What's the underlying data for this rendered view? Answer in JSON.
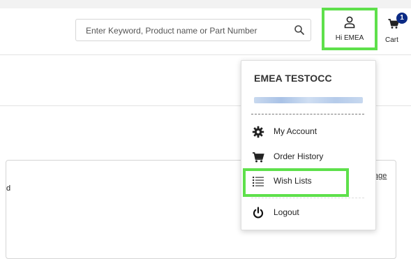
{
  "header": {
    "search_placeholder": "Enter Keyword, Product name or Part Number",
    "account_label": "Hi EMEA",
    "cart_label": "Cart",
    "cart_count": "1"
  },
  "account_menu": {
    "name": "EMEA TESTOCC",
    "items": [
      {
        "label": "My Account",
        "icon": "gear-icon"
      },
      {
        "label": "Order History",
        "icon": "cart-icon"
      },
      {
        "label": "Wish Lists",
        "icon": "list-icon"
      },
      {
        "label": "Logout",
        "icon": "power-icon"
      }
    ]
  },
  "content": {
    "left_fragment": "d",
    "right_link_fragment": "age"
  },
  "colors": {
    "highlight": "#5ee04b",
    "badge": "#0b2a84"
  }
}
